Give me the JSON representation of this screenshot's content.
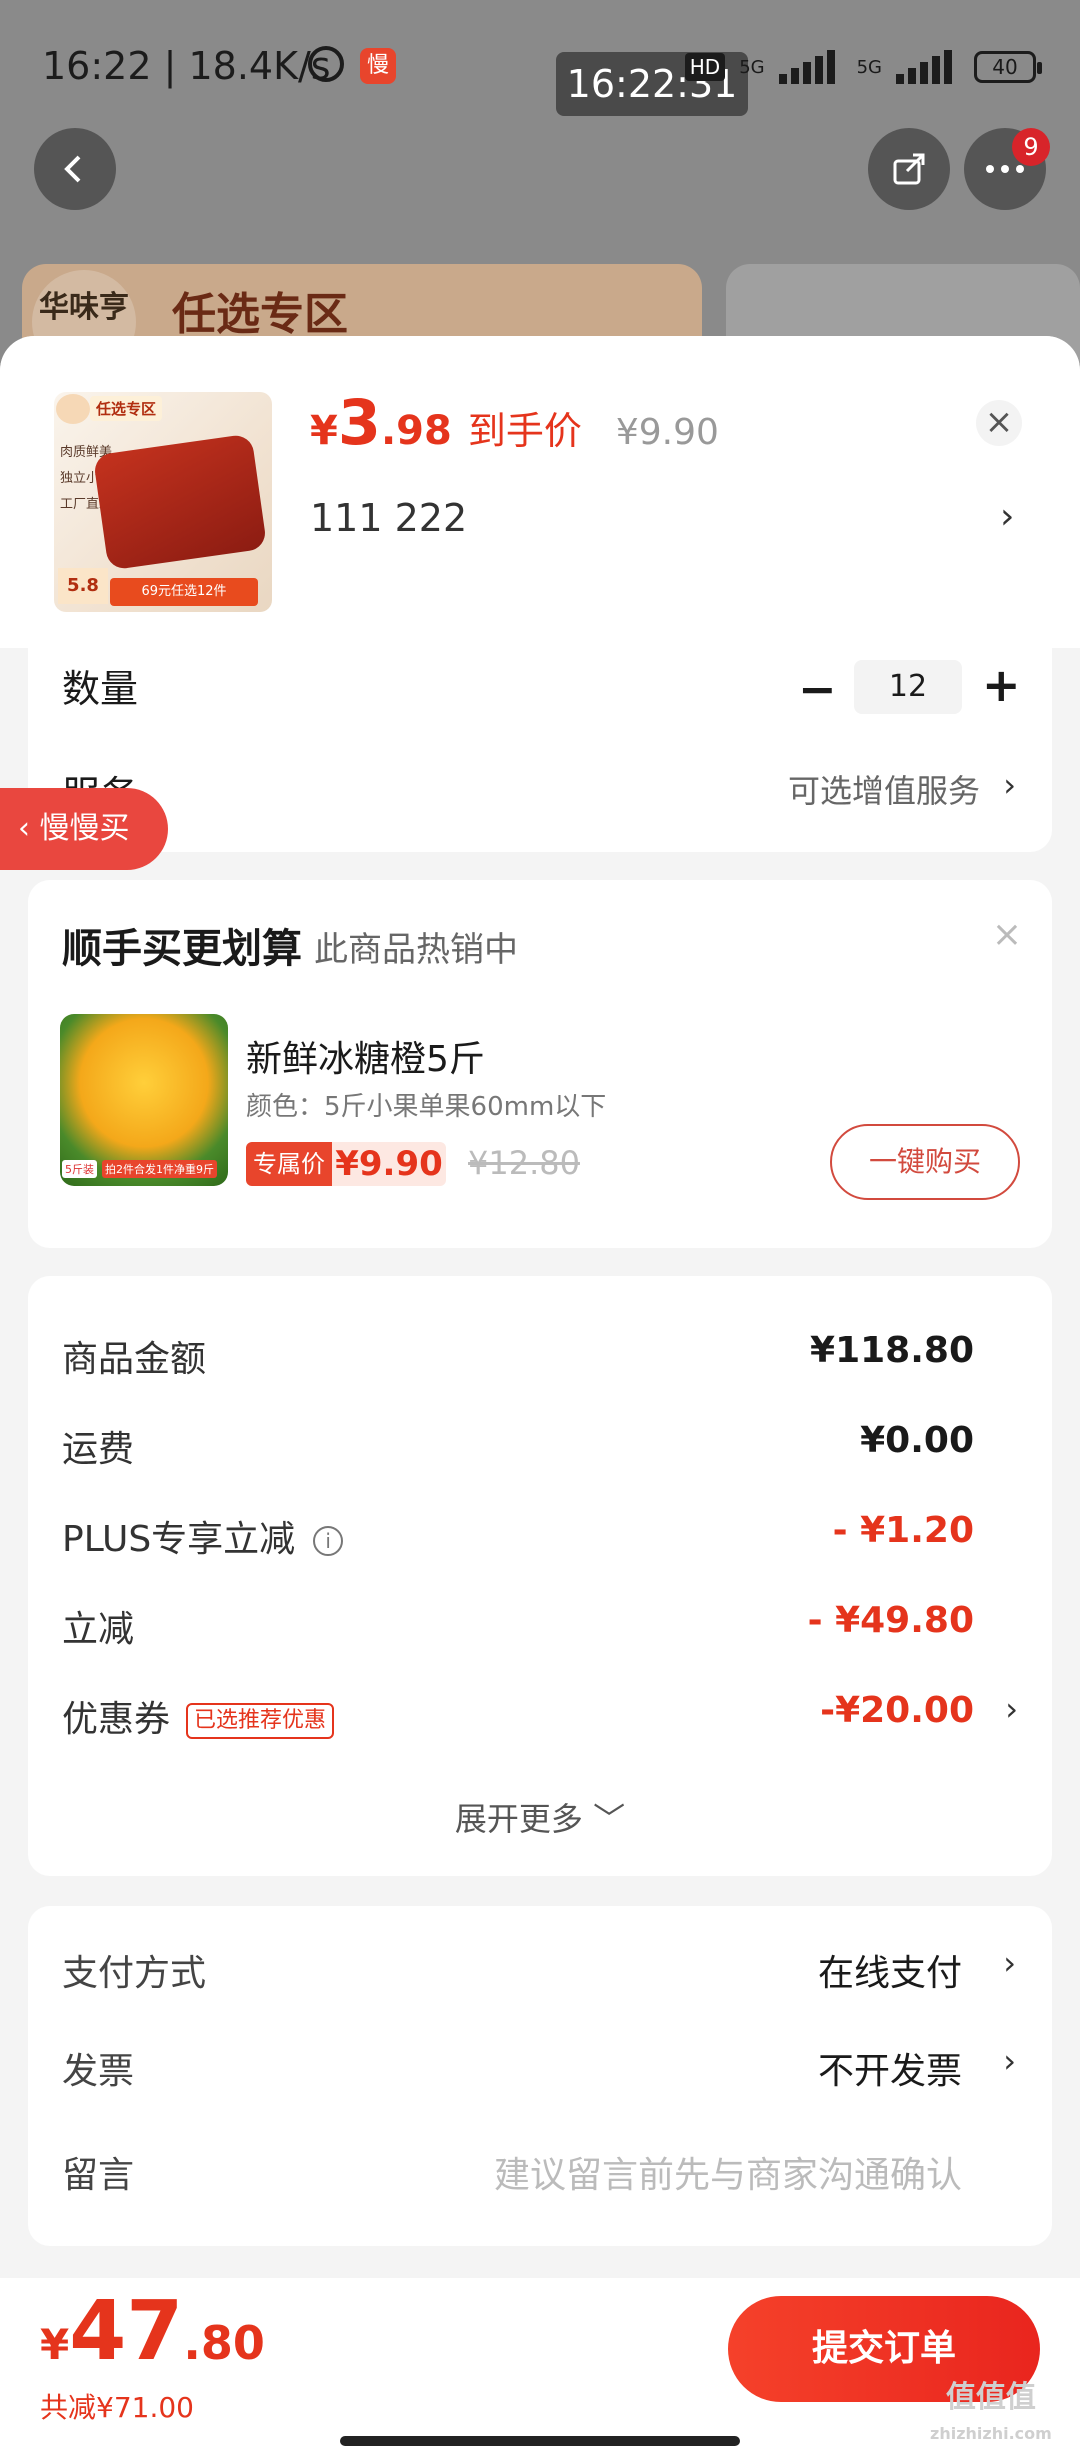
{
  "status_bar": {
    "time": "16:22 | 18.4K/s",
    "app_badge": "慢",
    "clock_overlay": "16:22:31",
    "hd_label": "HD",
    "net1": "5G",
    "net2": "5G",
    "battery": "40"
  },
  "background": {
    "banner_brand": "华味亨",
    "banner_title": "任选专区",
    "more_badge_count": "9"
  },
  "product": {
    "thumb_tag": "任选专区",
    "thumb_bullets": [
      "肉质鲜美",
      "独立小包装",
      "工厂直发"
    ],
    "thumb_price": "5.8",
    "thumb_strip": "69元任选12件",
    "price_symbol": "¥",
    "price_int": "3",
    "price_dec": ".98",
    "price_label": "到手价",
    "original_price": "¥9.90",
    "spec": "111  222"
  },
  "quantity": {
    "label": "数量",
    "value": "12"
  },
  "service": {
    "label": "服务",
    "hint": "可选增值服务"
  },
  "floating_pill": {
    "label": "慢慢买"
  },
  "upsell": {
    "title": "顺手买更划算",
    "subtitle": "此商品热销中",
    "img_badge1": "5斤装",
    "img_badge2": "拍2件合发1件净重9斤",
    "name": "新鲜冰糖橙5斤",
    "desc": "颜色：5斤小果单果60mm以下",
    "special_tag": "专属价",
    "price": "¥9.90",
    "original": "¥12.80",
    "buy_label": "一键购买"
  },
  "summary": {
    "rows": [
      {
        "label": "商品金额",
        "value": "¥118.80"
      },
      {
        "label": "运费",
        "value": "¥0.00"
      },
      {
        "label": "PLUS专享立减",
        "value": "- ¥1.20"
      },
      {
        "label": "立减",
        "value": "- ¥49.80"
      },
      {
        "label": "优惠券",
        "value": "-¥20.00",
        "tag": "已选推荐优惠"
      }
    ],
    "expand": "展开更多 ﹀"
  },
  "payment": {
    "method_label": "支付方式",
    "method_value": "在线支付",
    "invoice_label": "发票",
    "invoice_value": "不开发票",
    "note_label": "留言",
    "note_placeholder": "建议留言前先与商家沟通确认"
  },
  "bottom": {
    "total_symbol": "¥",
    "total_int": "47",
    "total_dec": ".80",
    "saved": "共减¥71.00",
    "submit": "提交订单"
  },
  "watermark": {
    "text": "值值值",
    "sub": "zhizhizhi.com"
  },
  "colors": {
    "accent_red": "#e5341c",
    "button_gradient_start": "#f5412a",
    "button_gradient_end": "#e9251e",
    "pill_red": "#e9473f"
  },
  "icons": [
    "back-arrow-icon",
    "share-icon",
    "more-dots-icon",
    "close-icon",
    "chevron-right-icon",
    "minus-icon",
    "plus-icon",
    "info-icon",
    "alarm-icon",
    "signal-icon",
    "battery-icon"
  ]
}
